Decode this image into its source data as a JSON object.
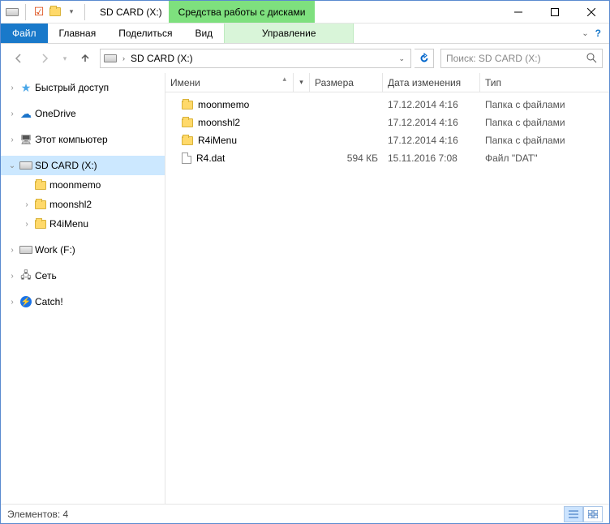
{
  "window": {
    "title": "SD CARD (X:)",
    "context_tab": "Средства работы с дисками",
    "context_subtab": "Управление"
  },
  "ribbon": {
    "file": "Файл",
    "home": "Главная",
    "share": "Поделиться",
    "view": "Вид"
  },
  "nav": {
    "address": "SD CARD (X:)",
    "search_placeholder": "Поиск: SD CARD (X:)"
  },
  "tree": {
    "quick_access": "Быстрый доступ",
    "onedrive": "OneDrive",
    "this_pc": "Этот компьютер",
    "sdcard": "SD CARD (X:)",
    "sd_children": [
      "moonmemo",
      "moonshl2",
      "R4iMenu"
    ],
    "work": "Work (F:)",
    "network": "Сеть",
    "catch": "Catch!"
  },
  "columns": {
    "name": "Имени",
    "size": "Размера",
    "date": "Дата изменения",
    "type": "Тип"
  },
  "files": [
    {
      "name": "moonmemo",
      "kind": "folder",
      "size": "",
      "date": "17.12.2014 4:16",
      "type": "Папка с файлами"
    },
    {
      "name": "moonshl2",
      "kind": "folder",
      "size": "",
      "date": "17.12.2014 4:16",
      "type": "Папка с файлами"
    },
    {
      "name": "R4iMenu",
      "kind": "folder",
      "size": "",
      "date": "17.12.2014 4:16",
      "type": "Папка с файлами"
    },
    {
      "name": "R4.dat",
      "kind": "file",
      "size": "594 КБ",
      "date": "15.11.2016 7:08",
      "type": "Файл \"DAT\""
    }
  ],
  "status": {
    "count_label": "Элементов: 4"
  }
}
